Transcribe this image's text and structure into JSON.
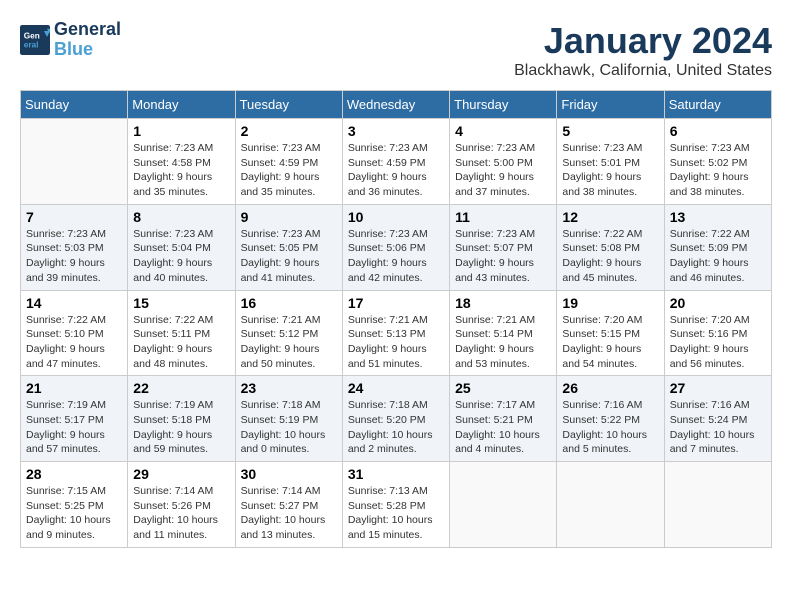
{
  "header": {
    "logo_line1": "General",
    "logo_line2": "Blue",
    "month": "January 2024",
    "location": "Blackhawk, California, United States"
  },
  "weekdays": [
    "Sunday",
    "Monday",
    "Tuesday",
    "Wednesday",
    "Thursday",
    "Friday",
    "Saturday"
  ],
  "weeks": [
    [
      {
        "day": "",
        "info": ""
      },
      {
        "day": "1",
        "info": "Sunrise: 7:23 AM\nSunset: 4:58 PM\nDaylight: 9 hours\nand 35 minutes."
      },
      {
        "day": "2",
        "info": "Sunrise: 7:23 AM\nSunset: 4:59 PM\nDaylight: 9 hours\nand 35 minutes."
      },
      {
        "day": "3",
        "info": "Sunrise: 7:23 AM\nSunset: 4:59 PM\nDaylight: 9 hours\nand 36 minutes."
      },
      {
        "day": "4",
        "info": "Sunrise: 7:23 AM\nSunset: 5:00 PM\nDaylight: 9 hours\nand 37 minutes."
      },
      {
        "day": "5",
        "info": "Sunrise: 7:23 AM\nSunset: 5:01 PM\nDaylight: 9 hours\nand 38 minutes."
      },
      {
        "day": "6",
        "info": "Sunrise: 7:23 AM\nSunset: 5:02 PM\nDaylight: 9 hours\nand 38 minutes."
      }
    ],
    [
      {
        "day": "7",
        "info": "Sunrise: 7:23 AM\nSunset: 5:03 PM\nDaylight: 9 hours\nand 39 minutes."
      },
      {
        "day": "8",
        "info": "Sunrise: 7:23 AM\nSunset: 5:04 PM\nDaylight: 9 hours\nand 40 minutes."
      },
      {
        "day": "9",
        "info": "Sunrise: 7:23 AM\nSunset: 5:05 PM\nDaylight: 9 hours\nand 41 minutes."
      },
      {
        "day": "10",
        "info": "Sunrise: 7:23 AM\nSunset: 5:06 PM\nDaylight: 9 hours\nand 42 minutes."
      },
      {
        "day": "11",
        "info": "Sunrise: 7:23 AM\nSunset: 5:07 PM\nDaylight: 9 hours\nand 43 minutes."
      },
      {
        "day": "12",
        "info": "Sunrise: 7:22 AM\nSunset: 5:08 PM\nDaylight: 9 hours\nand 45 minutes."
      },
      {
        "day": "13",
        "info": "Sunrise: 7:22 AM\nSunset: 5:09 PM\nDaylight: 9 hours\nand 46 minutes."
      }
    ],
    [
      {
        "day": "14",
        "info": "Sunrise: 7:22 AM\nSunset: 5:10 PM\nDaylight: 9 hours\nand 47 minutes."
      },
      {
        "day": "15",
        "info": "Sunrise: 7:22 AM\nSunset: 5:11 PM\nDaylight: 9 hours\nand 48 minutes."
      },
      {
        "day": "16",
        "info": "Sunrise: 7:21 AM\nSunset: 5:12 PM\nDaylight: 9 hours\nand 50 minutes."
      },
      {
        "day": "17",
        "info": "Sunrise: 7:21 AM\nSunset: 5:13 PM\nDaylight: 9 hours\nand 51 minutes."
      },
      {
        "day": "18",
        "info": "Sunrise: 7:21 AM\nSunset: 5:14 PM\nDaylight: 9 hours\nand 53 minutes."
      },
      {
        "day": "19",
        "info": "Sunrise: 7:20 AM\nSunset: 5:15 PM\nDaylight: 9 hours\nand 54 minutes."
      },
      {
        "day": "20",
        "info": "Sunrise: 7:20 AM\nSunset: 5:16 PM\nDaylight: 9 hours\nand 56 minutes."
      }
    ],
    [
      {
        "day": "21",
        "info": "Sunrise: 7:19 AM\nSunset: 5:17 PM\nDaylight: 9 hours\nand 57 minutes."
      },
      {
        "day": "22",
        "info": "Sunrise: 7:19 AM\nSunset: 5:18 PM\nDaylight: 9 hours\nand 59 minutes."
      },
      {
        "day": "23",
        "info": "Sunrise: 7:18 AM\nSunset: 5:19 PM\nDaylight: 10 hours\nand 0 minutes."
      },
      {
        "day": "24",
        "info": "Sunrise: 7:18 AM\nSunset: 5:20 PM\nDaylight: 10 hours\nand 2 minutes."
      },
      {
        "day": "25",
        "info": "Sunrise: 7:17 AM\nSunset: 5:21 PM\nDaylight: 10 hours\nand 4 minutes."
      },
      {
        "day": "26",
        "info": "Sunrise: 7:16 AM\nSunset: 5:22 PM\nDaylight: 10 hours\nand 5 minutes."
      },
      {
        "day": "27",
        "info": "Sunrise: 7:16 AM\nSunset: 5:24 PM\nDaylight: 10 hours\nand 7 minutes."
      }
    ],
    [
      {
        "day": "28",
        "info": "Sunrise: 7:15 AM\nSunset: 5:25 PM\nDaylight: 10 hours\nand 9 minutes."
      },
      {
        "day": "29",
        "info": "Sunrise: 7:14 AM\nSunset: 5:26 PM\nDaylight: 10 hours\nand 11 minutes."
      },
      {
        "day": "30",
        "info": "Sunrise: 7:14 AM\nSunset: 5:27 PM\nDaylight: 10 hours\nand 13 minutes."
      },
      {
        "day": "31",
        "info": "Sunrise: 7:13 AM\nSunset: 5:28 PM\nDaylight: 10 hours\nand 15 minutes."
      },
      {
        "day": "",
        "info": ""
      },
      {
        "day": "",
        "info": ""
      },
      {
        "day": "",
        "info": ""
      }
    ]
  ]
}
